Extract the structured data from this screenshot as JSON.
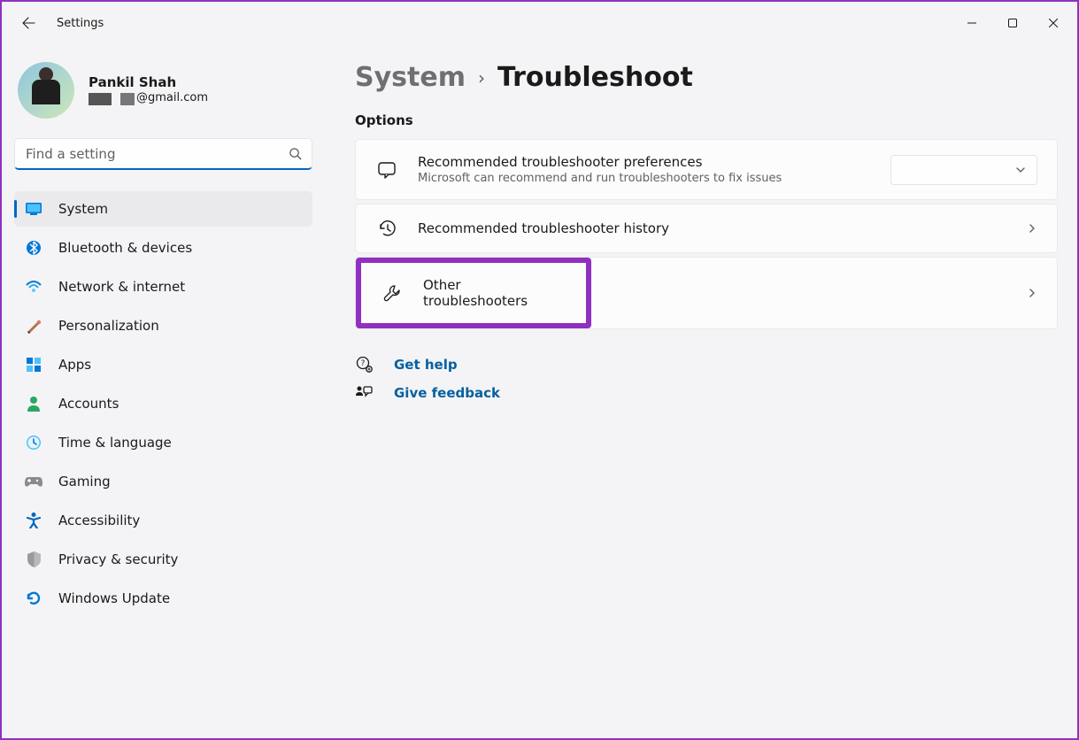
{
  "window": {
    "title": "Settings"
  },
  "profile": {
    "name": "Pankil Shah",
    "email_suffix": "@gmail.com"
  },
  "search": {
    "placeholder": "Find a setting"
  },
  "sidebar": {
    "items": [
      {
        "label": "System",
        "icon": "system"
      },
      {
        "label": "Bluetooth & devices",
        "icon": "bluetooth"
      },
      {
        "label": "Network & internet",
        "icon": "network"
      },
      {
        "label": "Personalization",
        "icon": "personalization"
      },
      {
        "label": "Apps",
        "icon": "apps"
      },
      {
        "label": "Accounts",
        "icon": "accounts"
      },
      {
        "label": "Time & language",
        "icon": "time"
      },
      {
        "label": "Gaming",
        "icon": "gaming"
      },
      {
        "label": "Accessibility",
        "icon": "accessibility"
      },
      {
        "label": "Privacy & security",
        "icon": "privacy"
      },
      {
        "label": "Windows Update",
        "icon": "update"
      }
    ]
  },
  "breadcrumb": {
    "parent": "System",
    "current": "Troubleshoot"
  },
  "section": {
    "title": "Options"
  },
  "options": {
    "preferences": {
      "title": "Recommended troubleshooter preferences",
      "subtitle": "Microsoft can recommend and run troubleshooters to fix issues"
    },
    "history": {
      "title": "Recommended troubleshooter history"
    },
    "other": {
      "title": "Other troubleshooters"
    }
  },
  "help": {
    "get_help": "Get help",
    "feedback": "Give feedback"
  }
}
